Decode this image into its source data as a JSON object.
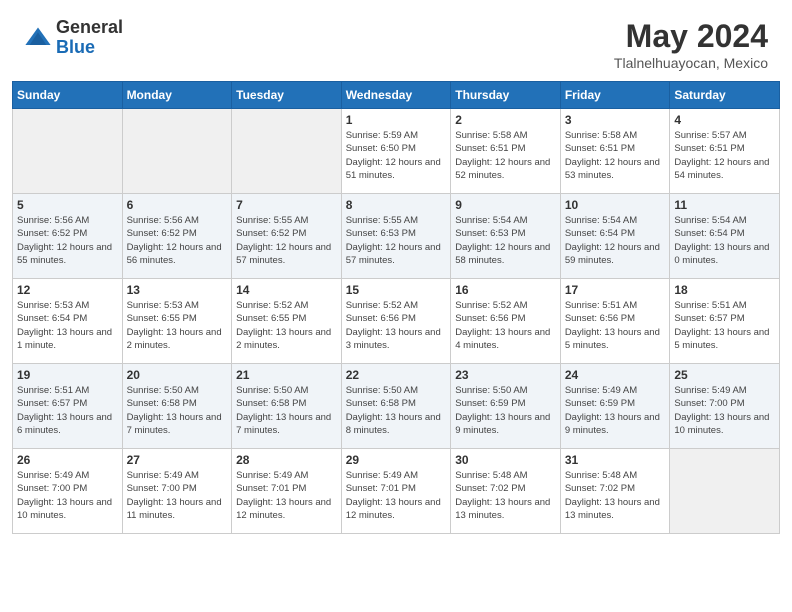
{
  "header": {
    "logo_general": "General",
    "logo_blue": "Blue",
    "month_title": "May 2024",
    "location": "Tlalnelhuayocan, Mexico"
  },
  "weekdays": [
    "Sunday",
    "Monday",
    "Tuesday",
    "Wednesday",
    "Thursday",
    "Friday",
    "Saturday"
  ],
  "weeks": [
    [
      {
        "day": "",
        "sunrise": "",
        "sunset": "",
        "daylight": ""
      },
      {
        "day": "",
        "sunrise": "",
        "sunset": "",
        "daylight": ""
      },
      {
        "day": "",
        "sunrise": "",
        "sunset": "",
        "daylight": ""
      },
      {
        "day": "1",
        "sunrise": "Sunrise: 5:59 AM",
        "sunset": "Sunset: 6:50 PM",
        "daylight": "Daylight: 12 hours and 51 minutes."
      },
      {
        "day": "2",
        "sunrise": "Sunrise: 5:58 AM",
        "sunset": "Sunset: 6:51 PM",
        "daylight": "Daylight: 12 hours and 52 minutes."
      },
      {
        "day": "3",
        "sunrise": "Sunrise: 5:58 AM",
        "sunset": "Sunset: 6:51 PM",
        "daylight": "Daylight: 12 hours and 53 minutes."
      },
      {
        "day": "4",
        "sunrise": "Sunrise: 5:57 AM",
        "sunset": "Sunset: 6:51 PM",
        "daylight": "Daylight: 12 hours and 54 minutes."
      }
    ],
    [
      {
        "day": "5",
        "sunrise": "Sunrise: 5:56 AM",
        "sunset": "Sunset: 6:52 PM",
        "daylight": "Daylight: 12 hours and 55 minutes."
      },
      {
        "day": "6",
        "sunrise": "Sunrise: 5:56 AM",
        "sunset": "Sunset: 6:52 PM",
        "daylight": "Daylight: 12 hours and 56 minutes."
      },
      {
        "day": "7",
        "sunrise": "Sunrise: 5:55 AM",
        "sunset": "Sunset: 6:52 PM",
        "daylight": "Daylight: 12 hours and 57 minutes."
      },
      {
        "day": "8",
        "sunrise": "Sunrise: 5:55 AM",
        "sunset": "Sunset: 6:53 PM",
        "daylight": "Daylight: 12 hours and 57 minutes."
      },
      {
        "day": "9",
        "sunrise": "Sunrise: 5:54 AM",
        "sunset": "Sunset: 6:53 PM",
        "daylight": "Daylight: 12 hours and 58 minutes."
      },
      {
        "day": "10",
        "sunrise": "Sunrise: 5:54 AM",
        "sunset": "Sunset: 6:54 PM",
        "daylight": "Daylight: 12 hours and 59 minutes."
      },
      {
        "day": "11",
        "sunrise": "Sunrise: 5:54 AM",
        "sunset": "Sunset: 6:54 PM",
        "daylight": "Daylight: 13 hours and 0 minutes."
      }
    ],
    [
      {
        "day": "12",
        "sunrise": "Sunrise: 5:53 AM",
        "sunset": "Sunset: 6:54 PM",
        "daylight": "Daylight: 13 hours and 1 minute."
      },
      {
        "day": "13",
        "sunrise": "Sunrise: 5:53 AM",
        "sunset": "Sunset: 6:55 PM",
        "daylight": "Daylight: 13 hours and 2 minutes."
      },
      {
        "day": "14",
        "sunrise": "Sunrise: 5:52 AM",
        "sunset": "Sunset: 6:55 PM",
        "daylight": "Daylight: 13 hours and 2 minutes."
      },
      {
        "day": "15",
        "sunrise": "Sunrise: 5:52 AM",
        "sunset": "Sunset: 6:56 PM",
        "daylight": "Daylight: 13 hours and 3 minutes."
      },
      {
        "day": "16",
        "sunrise": "Sunrise: 5:52 AM",
        "sunset": "Sunset: 6:56 PM",
        "daylight": "Daylight: 13 hours and 4 minutes."
      },
      {
        "day": "17",
        "sunrise": "Sunrise: 5:51 AM",
        "sunset": "Sunset: 6:56 PM",
        "daylight": "Daylight: 13 hours and 5 minutes."
      },
      {
        "day": "18",
        "sunrise": "Sunrise: 5:51 AM",
        "sunset": "Sunset: 6:57 PM",
        "daylight": "Daylight: 13 hours and 5 minutes."
      }
    ],
    [
      {
        "day": "19",
        "sunrise": "Sunrise: 5:51 AM",
        "sunset": "Sunset: 6:57 PM",
        "daylight": "Daylight: 13 hours and 6 minutes."
      },
      {
        "day": "20",
        "sunrise": "Sunrise: 5:50 AM",
        "sunset": "Sunset: 6:58 PM",
        "daylight": "Daylight: 13 hours and 7 minutes."
      },
      {
        "day": "21",
        "sunrise": "Sunrise: 5:50 AM",
        "sunset": "Sunset: 6:58 PM",
        "daylight": "Daylight: 13 hours and 7 minutes."
      },
      {
        "day": "22",
        "sunrise": "Sunrise: 5:50 AM",
        "sunset": "Sunset: 6:58 PM",
        "daylight": "Daylight: 13 hours and 8 minutes."
      },
      {
        "day": "23",
        "sunrise": "Sunrise: 5:50 AM",
        "sunset": "Sunset: 6:59 PM",
        "daylight": "Daylight: 13 hours and 9 minutes."
      },
      {
        "day": "24",
        "sunrise": "Sunrise: 5:49 AM",
        "sunset": "Sunset: 6:59 PM",
        "daylight": "Daylight: 13 hours and 9 minutes."
      },
      {
        "day": "25",
        "sunrise": "Sunrise: 5:49 AM",
        "sunset": "Sunset: 7:00 PM",
        "daylight": "Daylight: 13 hours and 10 minutes."
      }
    ],
    [
      {
        "day": "26",
        "sunrise": "Sunrise: 5:49 AM",
        "sunset": "Sunset: 7:00 PM",
        "daylight": "Daylight: 13 hours and 10 minutes."
      },
      {
        "day": "27",
        "sunrise": "Sunrise: 5:49 AM",
        "sunset": "Sunset: 7:00 PM",
        "daylight": "Daylight: 13 hours and 11 minutes."
      },
      {
        "day": "28",
        "sunrise": "Sunrise: 5:49 AM",
        "sunset": "Sunset: 7:01 PM",
        "daylight": "Daylight: 13 hours and 12 minutes."
      },
      {
        "day": "29",
        "sunrise": "Sunrise: 5:49 AM",
        "sunset": "Sunset: 7:01 PM",
        "daylight": "Daylight: 13 hours and 12 minutes."
      },
      {
        "day": "30",
        "sunrise": "Sunrise: 5:48 AM",
        "sunset": "Sunset: 7:02 PM",
        "daylight": "Daylight: 13 hours and 13 minutes."
      },
      {
        "day": "31",
        "sunrise": "Sunrise: 5:48 AM",
        "sunset": "Sunset: 7:02 PM",
        "daylight": "Daylight: 13 hours and 13 minutes."
      },
      {
        "day": "",
        "sunrise": "",
        "sunset": "",
        "daylight": ""
      }
    ]
  ]
}
